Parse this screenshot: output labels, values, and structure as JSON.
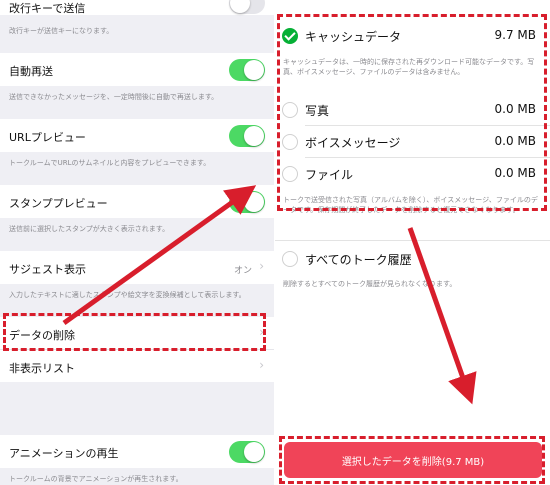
{
  "left": {
    "rows": [
      {
        "label": "改行キーで送信",
        "desc": "改行キーが送信キーになります。"
      },
      {
        "label": "自動再送",
        "desc": "送信できなかったメッセージを、一定時間後に自動で再送します。"
      },
      {
        "label": "URLプレビュー",
        "desc": "トークルームでURLのサムネイルと内容をプレビューできます。"
      },
      {
        "label": "スタンププレビュー",
        "desc": "送信前に選択したスタンプが大きく表示されます。"
      },
      {
        "label": "サジェスト表示",
        "value": "オン",
        "desc": "入力したテキストに適したスタンプや絵文字を変換候補として表示します。"
      },
      {
        "label": "データの削除"
      },
      {
        "label": "非表示リスト"
      },
      {
        "label": "アニメーションの再生",
        "desc": "トークルームの背景でアニメーションが再生されます。"
      }
    ]
  },
  "right": {
    "cache": {
      "label": "キャッシュデータ",
      "size": "9.7 MB",
      "desc": "キャッシュデータは、一時的に保存された再ダウンロード可能なデータです。写真、ボイスメッセージ、ファイルのデータは含みません。"
    },
    "items": [
      {
        "label": "写真",
        "size": "0.0 MB"
      },
      {
        "label": "ボイスメッセージ",
        "size": "0.0 MB"
      },
      {
        "label": "ファイル",
        "size": "0.0 MB"
      }
    ],
    "items_desc": "トークで送受信された写真（アルバムを除く）、ボイスメッセージ、ファイルのデータです。保存期間が終了したデータを削除すると復元できなくなります。",
    "all_history": {
      "label": "すべてのトーク履歴",
      "desc": "削除するとすべてのトーク履歴が見られなくなります。"
    },
    "delete_button": "選択したデータを削除(9.7 MB)"
  },
  "colors": {
    "accent_green": "#06b036",
    "toggle_green": "#4cd964",
    "delete_red": "#f04458",
    "annotation_red": "#d81e2c"
  }
}
